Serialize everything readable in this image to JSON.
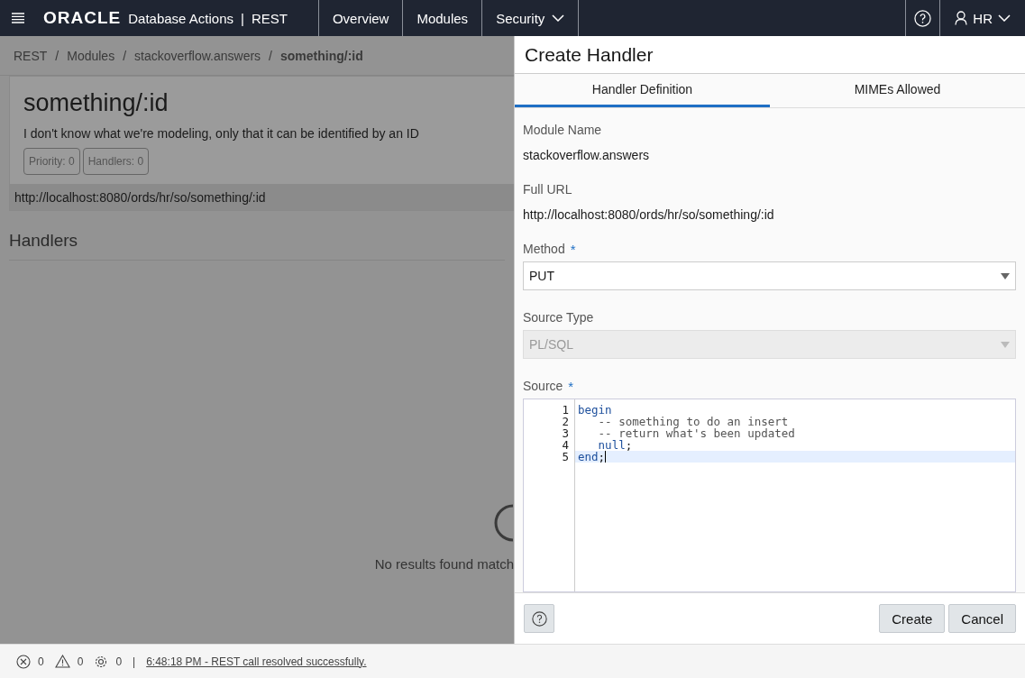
{
  "header": {
    "brand": "ORACLE",
    "app": "Database Actions",
    "separator": "|",
    "section": "REST",
    "nav": [
      {
        "label": "Overview",
        "dropdown": false
      },
      {
        "label": "Modules",
        "dropdown": false
      },
      {
        "label": "Security",
        "dropdown": true
      }
    ],
    "user": "HR"
  },
  "breadcrumb_separator": "/",
  "breadcrumbs": [
    {
      "label": "REST",
      "current": false
    },
    {
      "label": "Modules",
      "current": false
    },
    {
      "label": "stackoverflow.answers",
      "current": false
    },
    {
      "label": "something/:id",
      "current": true
    }
  ],
  "template": {
    "title": "something/:id",
    "description": "I don't know what we're modeling, only that it can be identified by an ID",
    "badges": [
      "Priority: 0",
      "Handlers: 0"
    ],
    "url": "http://localhost:8080/ords/hr/so/something/:id"
  },
  "handlers": {
    "title": "Handlers",
    "empty_message": "No results found match"
  },
  "dialog": {
    "title": "Create Handler",
    "tabs": [
      {
        "label": "Handler Definition",
        "selected": true
      },
      {
        "label": "MIMEs Allowed",
        "selected": false
      }
    ],
    "module_label": "Module Name",
    "module_value": "stackoverflow.answers",
    "url_label": "Full URL",
    "url_value": "http://localhost:8080/ords/hr/so/something/:id",
    "required_mark": "*",
    "method": {
      "label": "Method",
      "required": true,
      "value": "PUT",
      "disabled": false
    },
    "source_type": {
      "label": "Source Type",
      "value": "PL/SQL",
      "disabled": true
    },
    "source": {
      "label": "Source",
      "required": true,
      "lines": [
        {
          "number": "1",
          "current": false,
          "tokens": [
            {
              "text": "begin",
              "kind": "keyword"
            }
          ]
        },
        {
          "number": "2",
          "current": false,
          "tokens": [
            {
              "text": "   -- something to do an insert",
              "kind": "comment"
            }
          ]
        },
        {
          "number": "3",
          "current": false,
          "tokens": [
            {
              "text": "   -- return what's been updated",
              "kind": "comment"
            }
          ]
        },
        {
          "number": "4",
          "current": false,
          "tokens": [
            {
              "text": "   null",
              "kind": "keyword"
            },
            {
              "text": ";",
              "kind": "plain"
            }
          ]
        },
        {
          "number": "5",
          "current": true,
          "tokens": [
            {
              "text": "end",
              "kind": "keyword"
            },
            {
              "text": ";",
              "kind": "plain"
            }
          ]
        }
      ]
    },
    "buttons": [
      "Create",
      "Cancel"
    ]
  },
  "status_bar": {
    "errors": "0",
    "warnings": "0",
    "settings": "0",
    "separator": "|",
    "message": "6:48:18 PM - REST call resolved successfully."
  }
}
